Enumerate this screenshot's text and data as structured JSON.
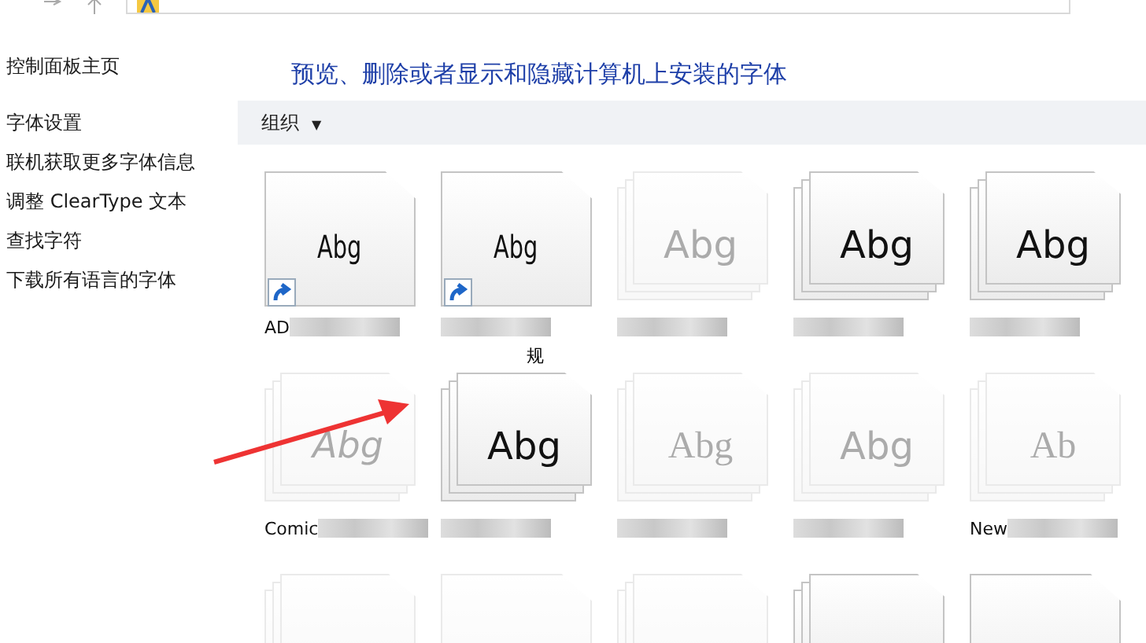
{
  "sidebar": {
    "items": [
      {
        "label": "控制面板主页"
      },
      {
        "label": "字体设置"
      },
      {
        "label": "联机获取更多字体信息"
      },
      {
        "label": "调整 ClearType 文本"
      },
      {
        "label": "查找字符"
      },
      {
        "label": "下载所有语言的字体"
      }
    ]
  },
  "heading": "预览、删除或者显示和隐藏计算机上安装的字体",
  "toolbar": {
    "organize": "组织",
    "caret": "▼"
  },
  "fonts": [
    {
      "kind": "shortcut",
      "hidden": false,
      "sample": "Abg",
      "label": "AD"
    },
    {
      "kind": "shortcut",
      "hidden": false,
      "sample": "Abg",
      "label_line_2": "规"
    },
    {
      "kind": "family",
      "hidden": true,
      "sample": "Abg"
    },
    {
      "kind": "family",
      "hidden": false,
      "sample": "Abg"
    },
    {
      "kind": "family",
      "hidden": false,
      "sample": "Abg"
    },
    {
      "kind": "family",
      "hidden": true,
      "sample": "Abg",
      "label": "Comic"
    },
    {
      "kind": "family",
      "hidden": false,
      "sample": "Abg"
    },
    {
      "kind": "family",
      "hidden": true,
      "sample": "Abg"
    },
    {
      "kind": "family",
      "hidden": true,
      "sample": "Abg"
    },
    {
      "kind": "family",
      "hidden": true,
      "sample": "Ab",
      "label": "New"
    },
    {
      "kind": "family",
      "hidden": true
    },
    {
      "kind": "single",
      "hidden": true
    },
    {
      "kind": "family",
      "hidden": true
    },
    {
      "kind": "family",
      "hidden": false
    },
    {
      "kind": "single",
      "hidden": false
    }
  ]
}
